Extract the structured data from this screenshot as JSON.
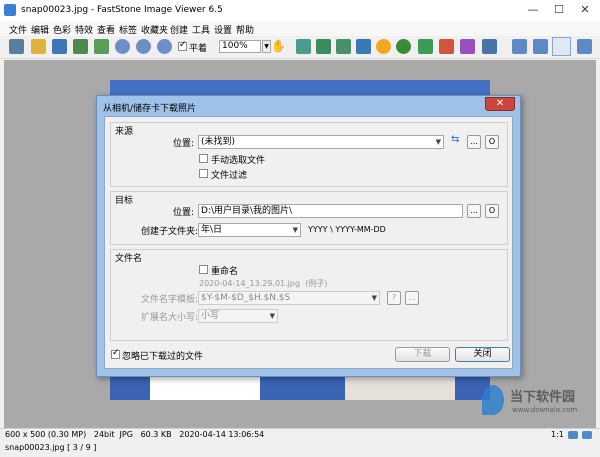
{
  "window": {
    "title": "snap00023.jpg - FastStone Image Viewer 6.5",
    "minimize": "—",
    "maximize": "☐",
    "close": "✕"
  },
  "menu": [
    "文件",
    "编辑",
    "色彩",
    "特效",
    "查看",
    "标签",
    "收藏夹",
    "创建",
    "工具",
    "设置",
    "帮助"
  ],
  "toolbar": {
    "zoom_value": "100%",
    "checkbox_label": "平着",
    "checkbox_checked": true
  },
  "dialog": {
    "title": "从相机/储存卡下载照片",
    "close": "✕",
    "source": {
      "header": "来源",
      "location_label": "位置:",
      "location_value": "(未找到)",
      "manual_select_label": "手动选取文件",
      "file_filter_label": "文件过滤",
      "browse": "...",
      "settings": "O"
    },
    "target": {
      "header": "目标",
      "location_label": "位置:",
      "location_value": "D:\\用户目录\\我的图片\\",
      "subfolder_label": "创建子文件夹:",
      "subfolder_value": "年\\日",
      "subfolder_hint": "YYYY \\ YYYY-MM-DD",
      "browse": "...",
      "settings": "O"
    },
    "filename": {
      "header": "文件名",
      "rename_label": "重命名",
      "example": "2020-04-14_13.29.01.jpg  (例子)",
      "template_label": "文件名字模板:",
      "template_value": "$Y-$M-$D_$H.$N.$S",
      "ext_case_label": "扩展名大小写:",
      "ext_case_value": "小写",
      "help": "?",
      "browse": "..."
    },
    "ignore_label": "忽略已下载过的文件",
    "ignore_checked": true,
    "download_button": "下载",
    "close_button": "关闭"
  },
  "status": {
    "info": "600 x 500 (0.30 MP)   24bit  JPG   60.3 KB   2020-04-14 13:06:54",
    "file": "snap00023.jpg [ 3 / 9 ]",
    "zoom": "1:1"
  },
  "watermark": {
    "title": "当下软件园",
    "url": "www.downxia.com"
  }
}
